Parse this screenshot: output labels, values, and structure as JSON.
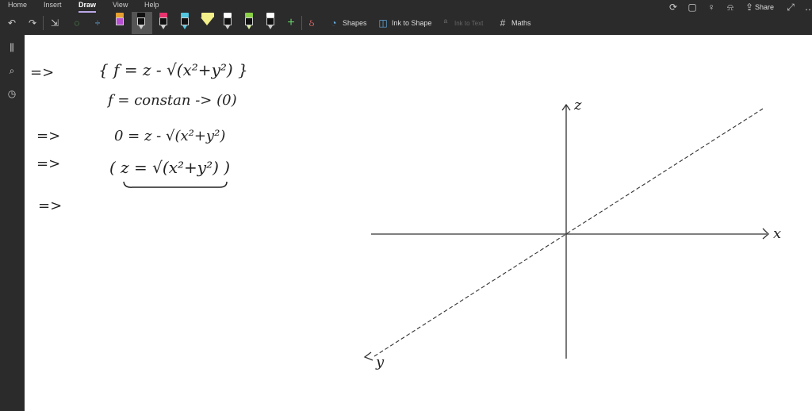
{
  "ribbon": {
    "tabs": [
      "Home",
      "Insert",
      "Draw",
      "View",
      "Help"
    ],
    "active_tab": "Draw",
    "tools": {
      "shapes": "Shapes",
      "ink_to_shape": "Ink to Shape",
      "ink_to_text": "Ink to Text",
      "maths": "Maths"
    },
    "pens": [
      {
        "color": "#b84fd0"
      },
      {
        "color": "#111111"
      },
      {
        "color": "#e8336e"
      },
      {
        "color": "#53c6e0"
      },
      {
        "color": "#f4f08a"
      },
      {
        "color": "#111111"
      },
      {
        "color": "#8ad045"
      },
      {
        "color": "#ffffff"
      }
    ],
    "share": "Share"
  },
  "notes": {
    "arrows": [
      "=>",
      "=>",
      "=>",
      "=>"
    ],
    "line1": "{ f = z - √(x²+y²) }",
    "line2": "f = constan -> (0)",
    "line3": "0 = z - √(x²+y²)",
    "line4": "( z = √(x²+y²) )",
    "axis_z": "z",
    "axis_x": "x",
    "axis_y": "y"
  }
}
